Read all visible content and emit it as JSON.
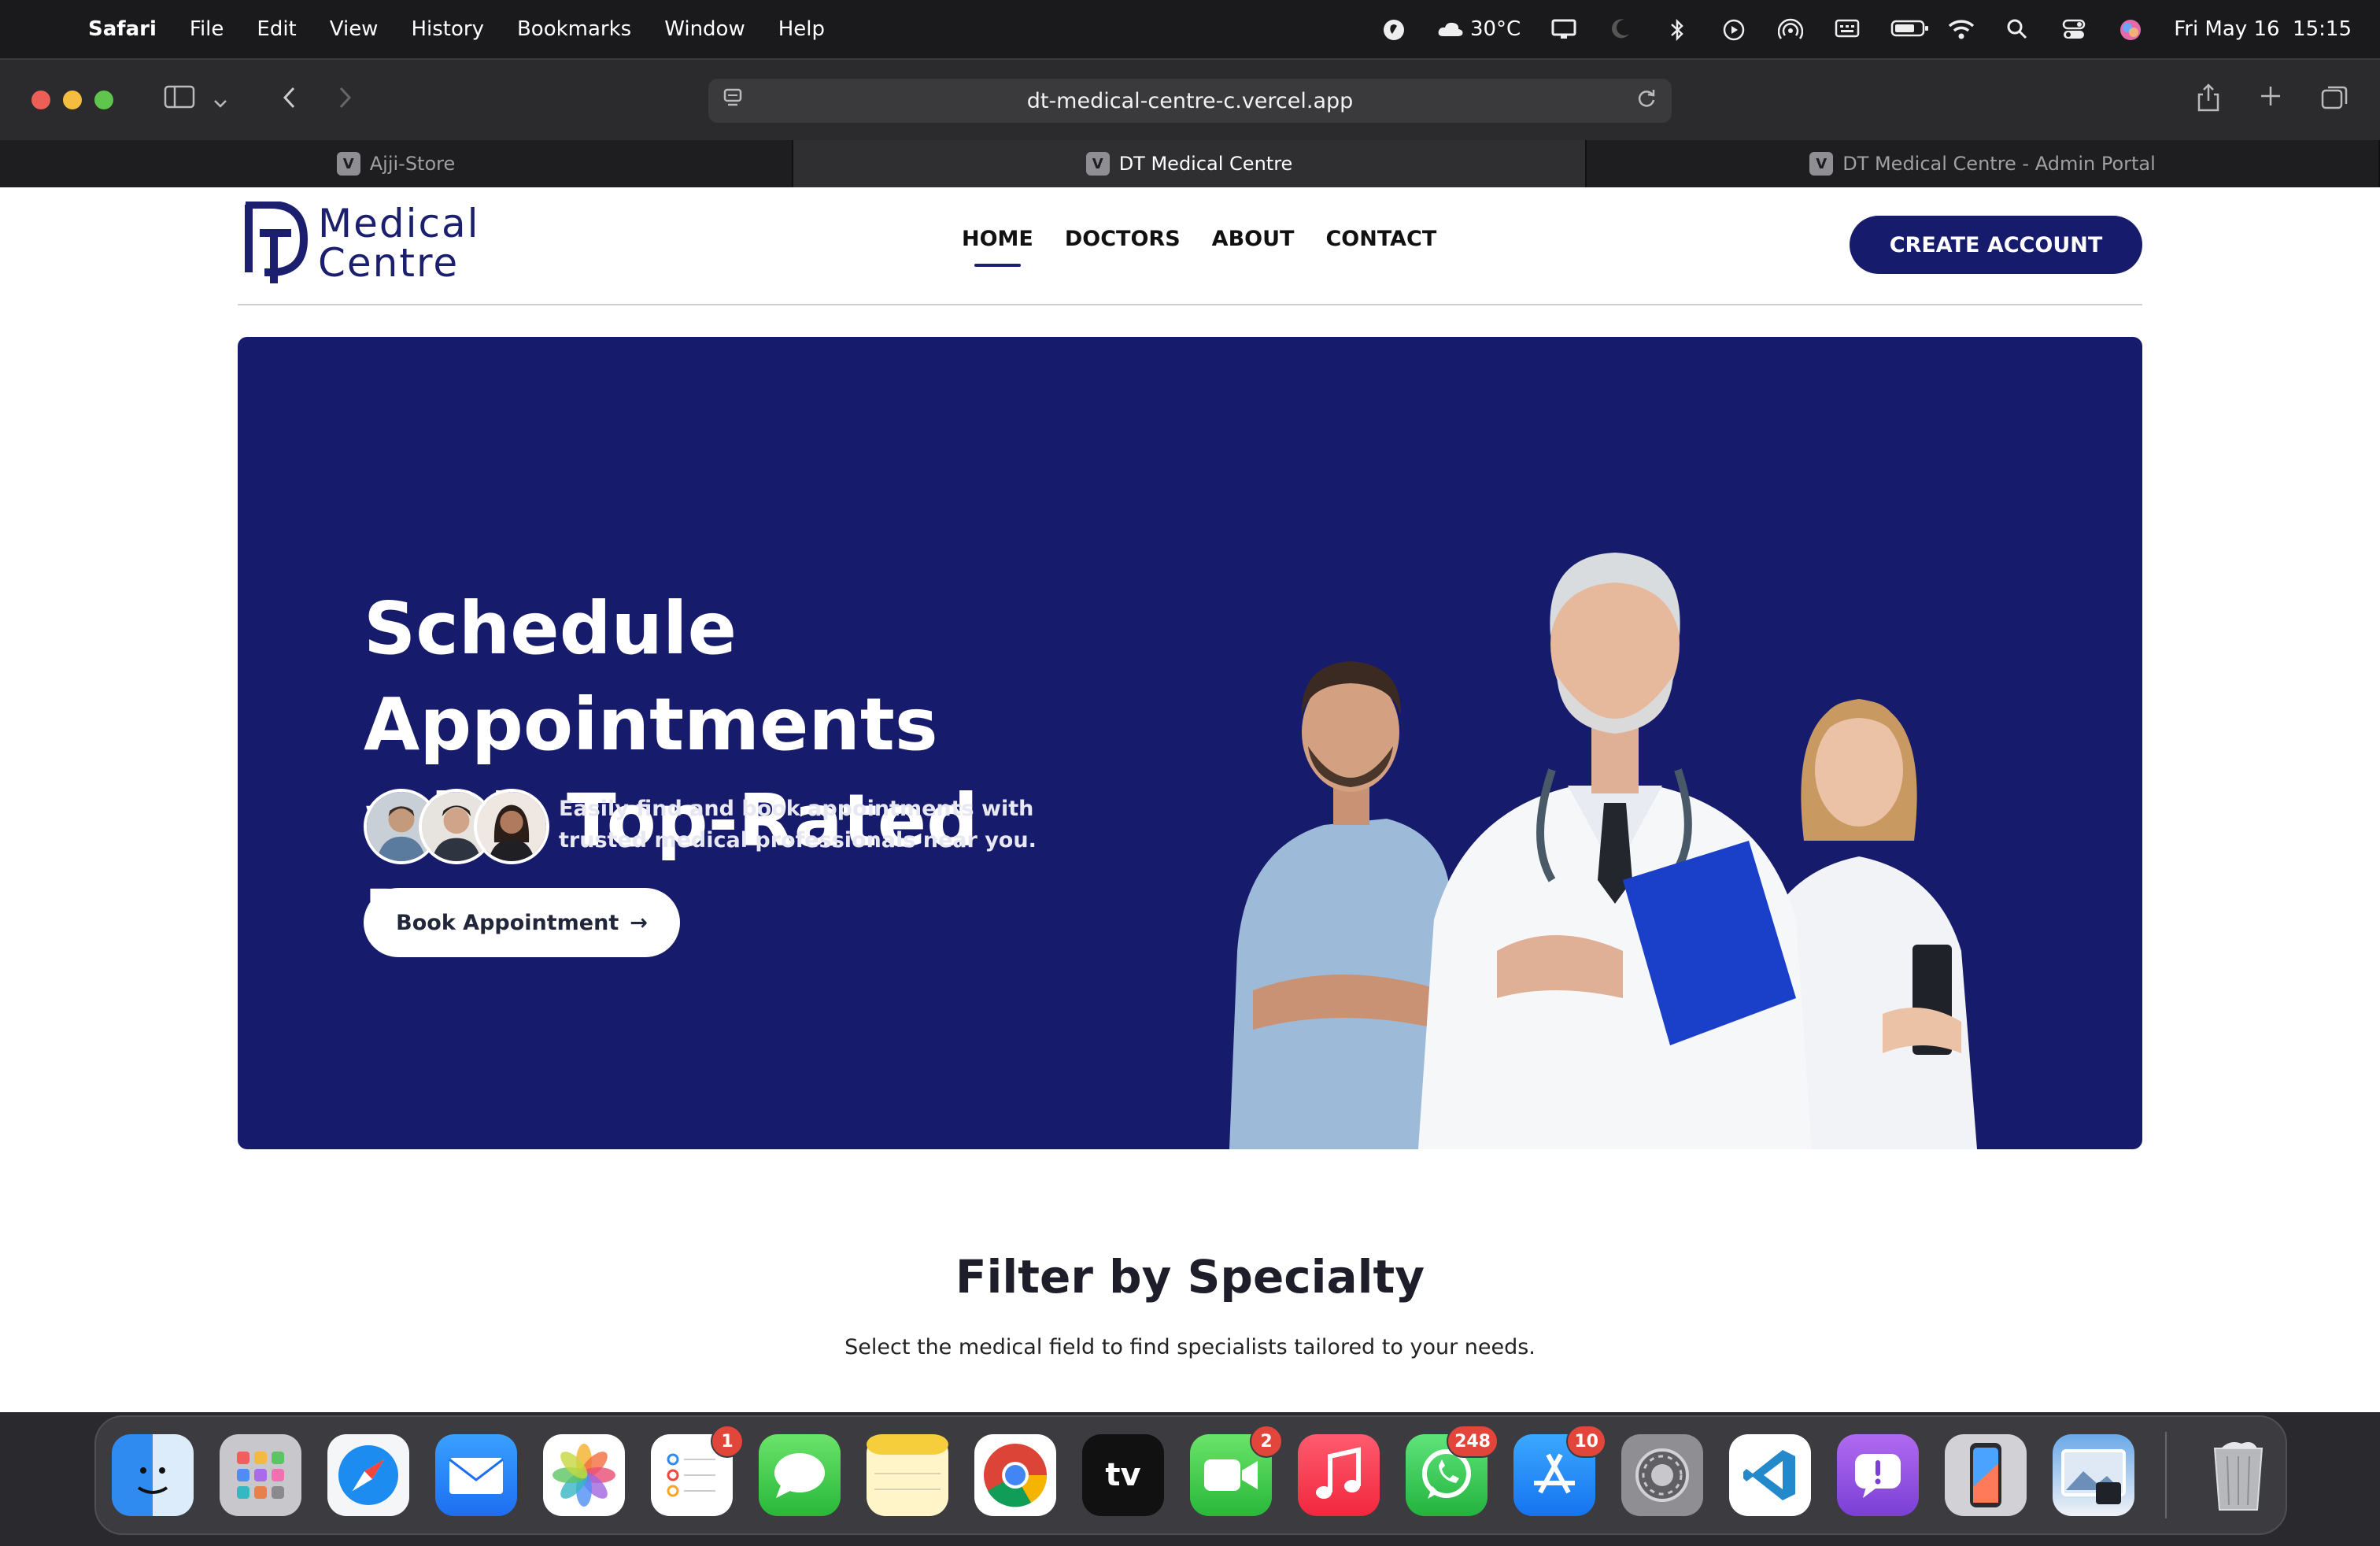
{
  "menubar": {
    "app_name": "Safari",
    "menus": [
      "File",
      "Edit",
      "View",
      "History",
      "Bookmarks",
      "Window",
      "Help"
    ],
    "weather": "30°C",
    "datetime": "Fri May 16  15:15"
  },
  "browser": {
    "url": "dt-medical-centre-c.vercel.app",
    "tabs": [
      {
        "label": "Ajji-Store",
        "favicon": "V"
      },
      {
        "label": "DT Medical Centre",
        "favicon": "V"
      },
      {
        "label": "DT Medical Centre - Admin Portal",
        "favicon": "V"
      }
    ]
  },
  "site": {
    "logo": {
      "line1": "Medical",
      "line2": "Centre"
    },
    "nav": [
      "HOME",
      "DOCTORS",
      "ABOUT",
      "CONTACT"
    ],
    "cta": "CREATE ACCOUNT",
    "hero": {
      "title_line1": "Schedule Appointments",
      "title_line2": "with Top-Rated Doctors",
      "subtitle": "Easily find and book appointments with trusted medical professionals near you.",
      "button": "Book Appointment",
      "button_icon": "→"
    },
    "filter": {
      "title": "Filter by Specialty",
      "subtitle": "Select the medical field to find specialists tailored to your needs."
    }
  },
  "dock": {
    "badges": {
      "reminders": "1",
      "facetime": "2",
      "whatsapp": "248",
      "appstore": "10"
    }
  },
  "colors": {
    "brand": "#171b6b",
    "white": "#ffffff"
  }
}
